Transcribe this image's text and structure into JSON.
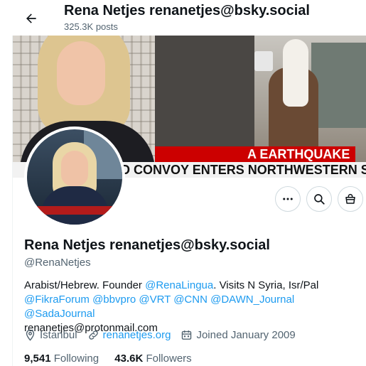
{
  "header": {
    "title": "Rena Netjes renanetjes@bsky.social",
    "posts_count": "325.3K posts"
  },
  "banner": {
    "ticker_top": "A EARTHQUAKE",
    "ticker_bottom": "D CONVOY ENTERS NORTHWESTERN SYRIA"
  },
  "actions": {
    "more_icon": "more-horizontal-icon",
    "search_icon": "search-icon",
    "shop_icon": "shopping-bag-icon"
  },
  "profile": {
    "name": "Rena Netjes renanetjes@bsky.social",
    "handle": "@RenaNetjes",
    "bio": {
      "line1_text": "Arabist/Hebrew. Founder ",
      "line1_link": "@RenaLingua",
      "line1_tail": ". Visits N Syria, Isr/Pal",
      "mentions": [
        "@FikraForum",
        "@bbvpro",
        "@VRT",
        "@CNN",
        "@DAWN_Journal",
        "@SadaJournal"
      ],
      "email": "renanetjes@protonmail.com"
    },
    "location": "Istanbul",
    "website": "renanetjes.org",
    "joined": "Joined January 2009",
    "following_count": "9,541",
    "following_label": "Following",
    "followers_count": "43.6K",
    "followers_label": "Followers"
  },
  "colors": {
    "accent": "#1d9bf0",
    "text": "#0f1419",
    "secondary": "#536471"
  }
}
